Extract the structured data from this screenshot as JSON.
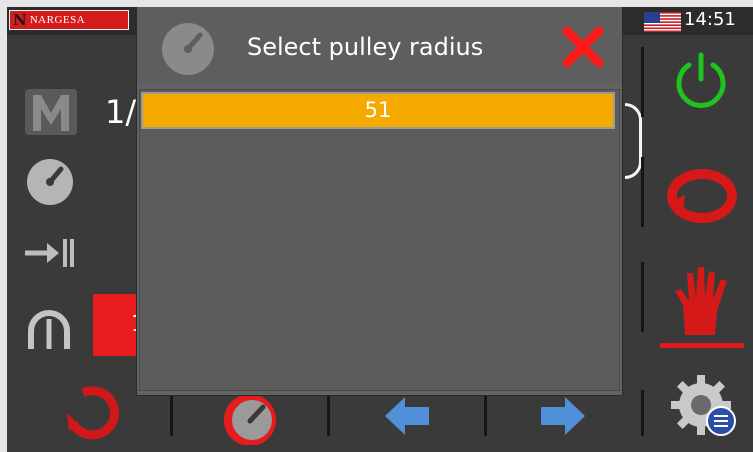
{
  "topbar": {
    "brand_initial": "N",
    "brand_name": "NARGESA",
    "time": "14:51",
    "language_flag": "us-flag-icon"
  },
  "background": {
    "fraction_fragment": "1/",
    "counter_fragment": "1"
  },
  "dialog": {
    "title": "Select pulley radius",
    "icon": "gauge-icon",
    "close_icon": "close-icon",
    "options": [
      "51"
    ],
    "selected": "51"
  },
  "colors": {
    "selection": "#f5aa00",
    "close": "#ff1a1a",
    "power": "#1fc21f",
    "accent_red": "#e21b1b",
    "arrow_blue": "#4f90d8"
  }
}
